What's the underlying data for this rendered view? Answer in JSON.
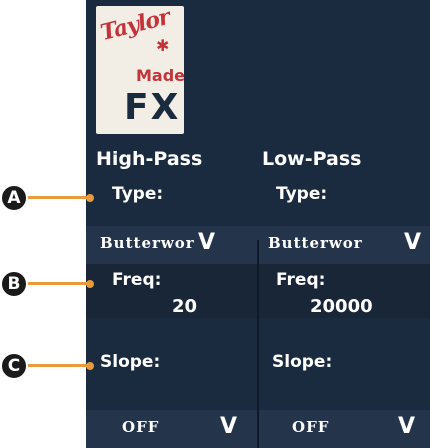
{
  "logo": {
    "script": "Taylor",
    "made": "Made",
    "fx": "FX"
  },
  "highpass": {
    "title": "High-Pass",
    "type_label": "Type:",
    "type_value": "Butterwor",
    "freq_label": "Freq:",
    "freq_value": "20",
    "slope_label": "Slope:",
    "slope_value": "OFF"
  },
  "lowpass": {
    "title": "Low-Pass",
    "type_label": "Type:",
    "type_value": "Butterwor",
    "freq_label": "Freq:",
    "freq_value": "20000",
    "slope_label": "Slope:",
    "slope_value": "OFF"
  },
  "callouts": [
    "A",
    "B",
    "C"
  ],
  "colors": {
    "panel": "#1a2a3f",
    "accent": "#e89a3c"
  }
}
